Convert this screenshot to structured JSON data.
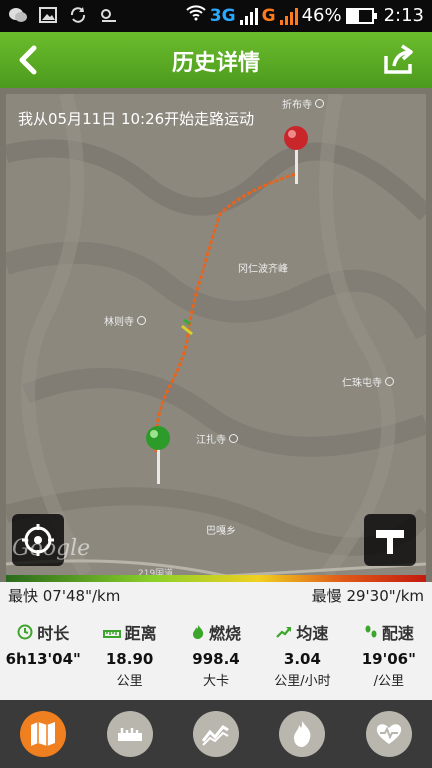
{
  "status_bar": {
    "network_3g": "3G",
    "network_g": "G",
    "battery": "46%",
    "time": "2:13"
  },
  "header": {
    "title": "历史详情"
  },
  "map": {
    "caption": "我从05月11日 10:26开始走路运动",
    "places": {
      "zhebu": "折布寺",
      "gangren": "冈仁波齐峰",
      "linze": "林则寺",
      "renzhutun": "仁珠屯寺",
      "jiangzha": "江扎寺",
      "bagai": "巴嘎乡",
      "road": "219国道"
    },
    "watermark": "Google"
  },
  "pace": {
    "fastest": "最快 07'48\"/km",
    "slowest": "最慢 29'30\"/km"
  },
  "stats": [
    {
      "label": "时长",
      "value": "6h13'04\"",
      "unit": ""
    },
    {
      "label": "距离",
      "value": "18.90",
      "unit": "公里"
    },
    {
      "label": "燃烧",
      "value": "998.4",
      "unit": "大卡"
    },
    {
      "label": "均速",
      "value": "3.04",
      "unit": "公里/小时"
    },
    {
      "label": "配速",
      "value": "19'06\"",
      "unit": "/公里"
    }
  ],
  "icons": {
    "time": "clock-icon",
    "distance": "ruler-icon",
    "burn": "flame-icon",
    "speed": "trend-arrow-icon",
    "pace": "footprint-icon"
  },
  "colors": {
    "accent_green": "#5aa924",
    "tab_active": "#ef7f1f",
    "route_orange": "#e8641a"
  }
}
